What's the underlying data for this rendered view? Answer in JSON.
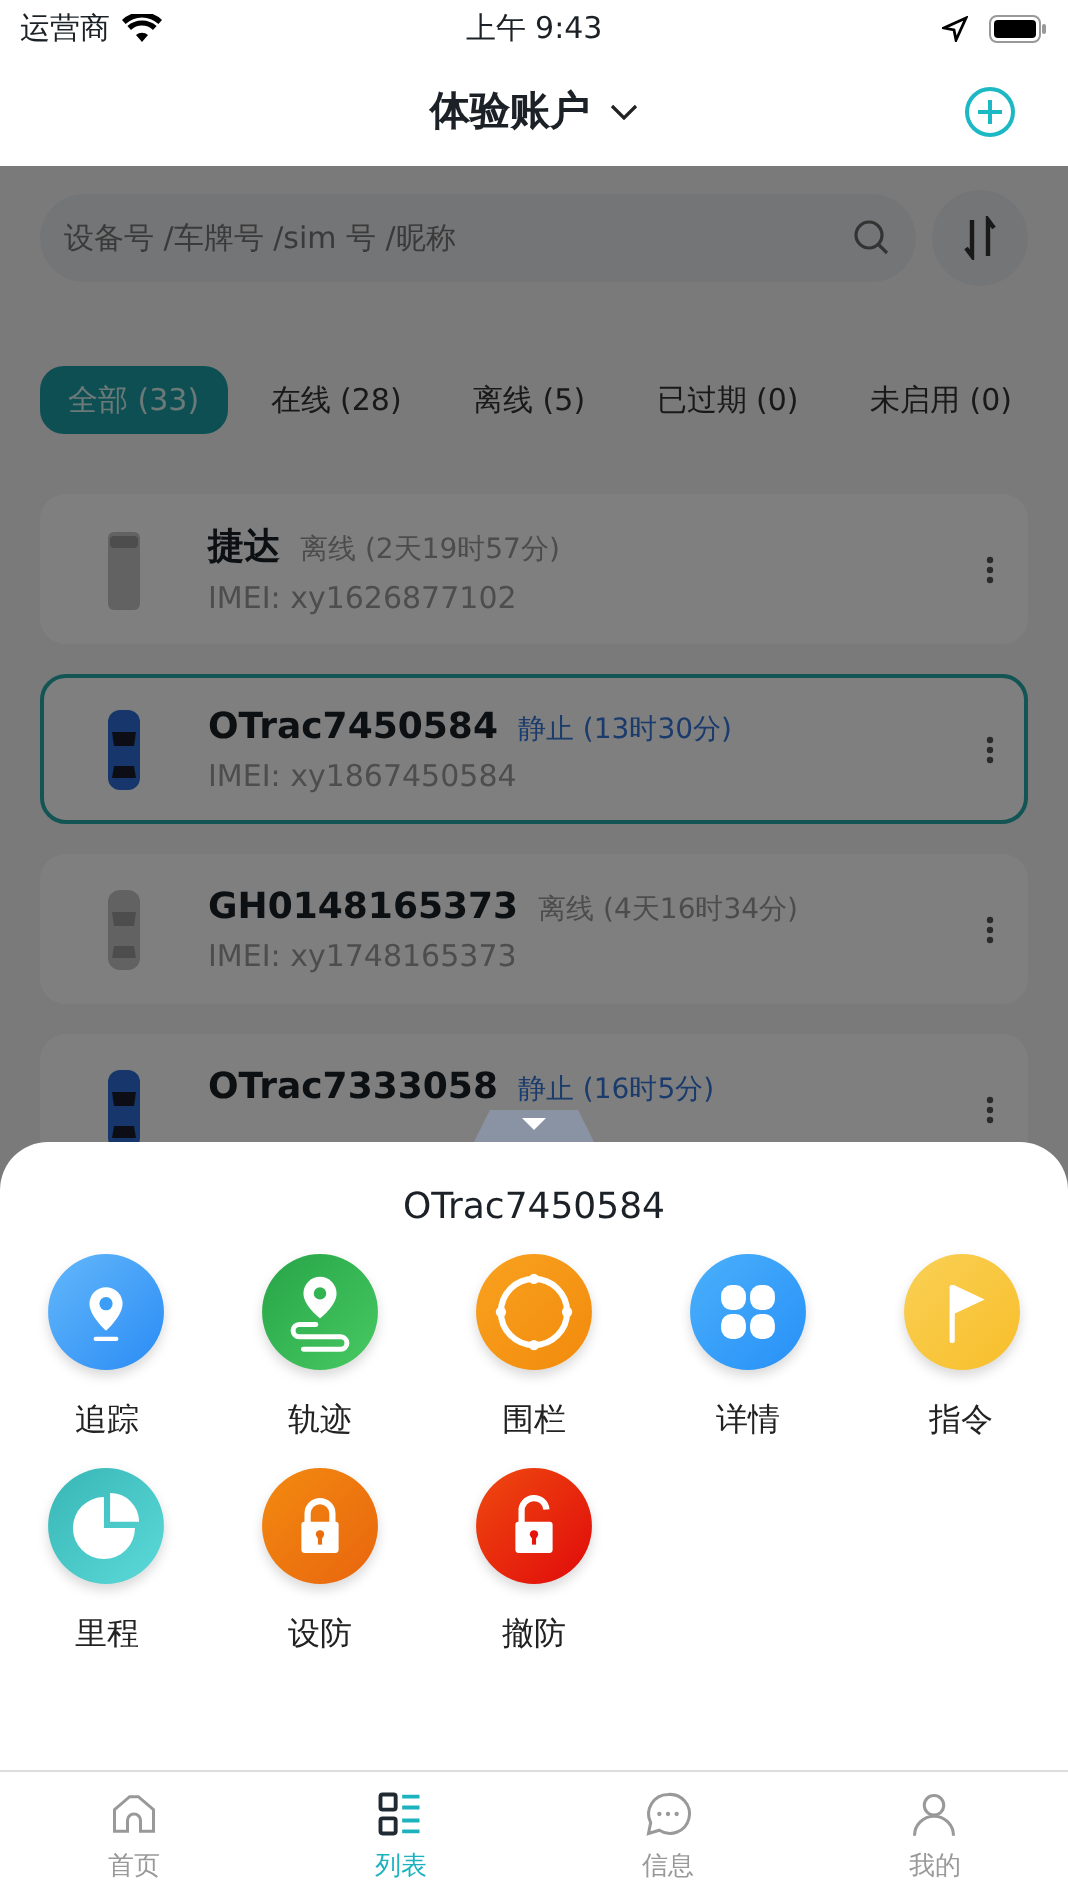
{
  "status_bar": {
    "carrier": "运营商",
    "time": "上午 9:43"
  },
  "header": {
    "title": "体验账户"
  },
  "search": {
    "placeholder": "设备号 /车牌号 /sim 号 /昵称"
  },
  "filters": [
    {
      "label": "全部 (33)",
      "selected": true
    },
    {
      "label": "在线 (28)",
      "selected": false
    },
    {
      "label": "离线 (5)",
      "selected": false
    },
    {
      "label": "已过期 (0)",
      "selected": false
    },
    {
      "label": "未启用 (0)",
      "selected": false
    }
  ],
  "vehicles": [
    {
      "name": "捷达",
      "status": "离线 (2天19时57分)",
      "kind": "offline",
      "van": true,
      "imei": "IMEI: xy1626877102",
      "selected": false
    },
    {
      "name": "OTrac7450584",
      "status": "静止 (13时30分)",
      "kind": "stopped",
      "van": false,
      "imei": "IMEI: xy1867450584",
      "selected": true
    },
    {
      "name": "GH0148165373",
      "status": "离线 (4天16时34分)",
      "kind": "offline",
      "van": false,
      "imei": "IMEI: xy1748165373",
      "selected": false
    },
    {
      "name": "OTrac7333058",
      "status": "静止 (16时5分)",
      "kind": "stopped",
      "van": false,
      "selected": false
    }
  ],
  "sheet": {
    "title": "OTrac7450584",
    "actions": [
      {
        "label": "追踪",
        "kind": "track"
      },
      {
        "label": "轨迹",
        "kind": "route"
      },
      {
        "label": "围栏",
        "kind": "fence"
      },
      {
        "label": "详情",
        "kind": "details"
      },
      {
        "label": "指令",
        "kind": "command"
      },
      {
        "label": "里程",
        "kind": "mileage"
      },
      {
        "label": "设防",
        "kind": "arm"
      },
      {
        "label": "撤防",
        "kind": "disarm"
      }
    ]
  },
  "tab_bar": [
    {
      "label": "首页",
      "kind": "home",
      "selected": false
    },
    {
      "label": "列表",
      "kind": "list",
      "selected": true
    },
    {
      "label": "信息",
      "kind": "message",
      "selected": false
    },
    {
      "label": "我的",
      "kind": "profile",
      "selected": false
    }
  ]
}
